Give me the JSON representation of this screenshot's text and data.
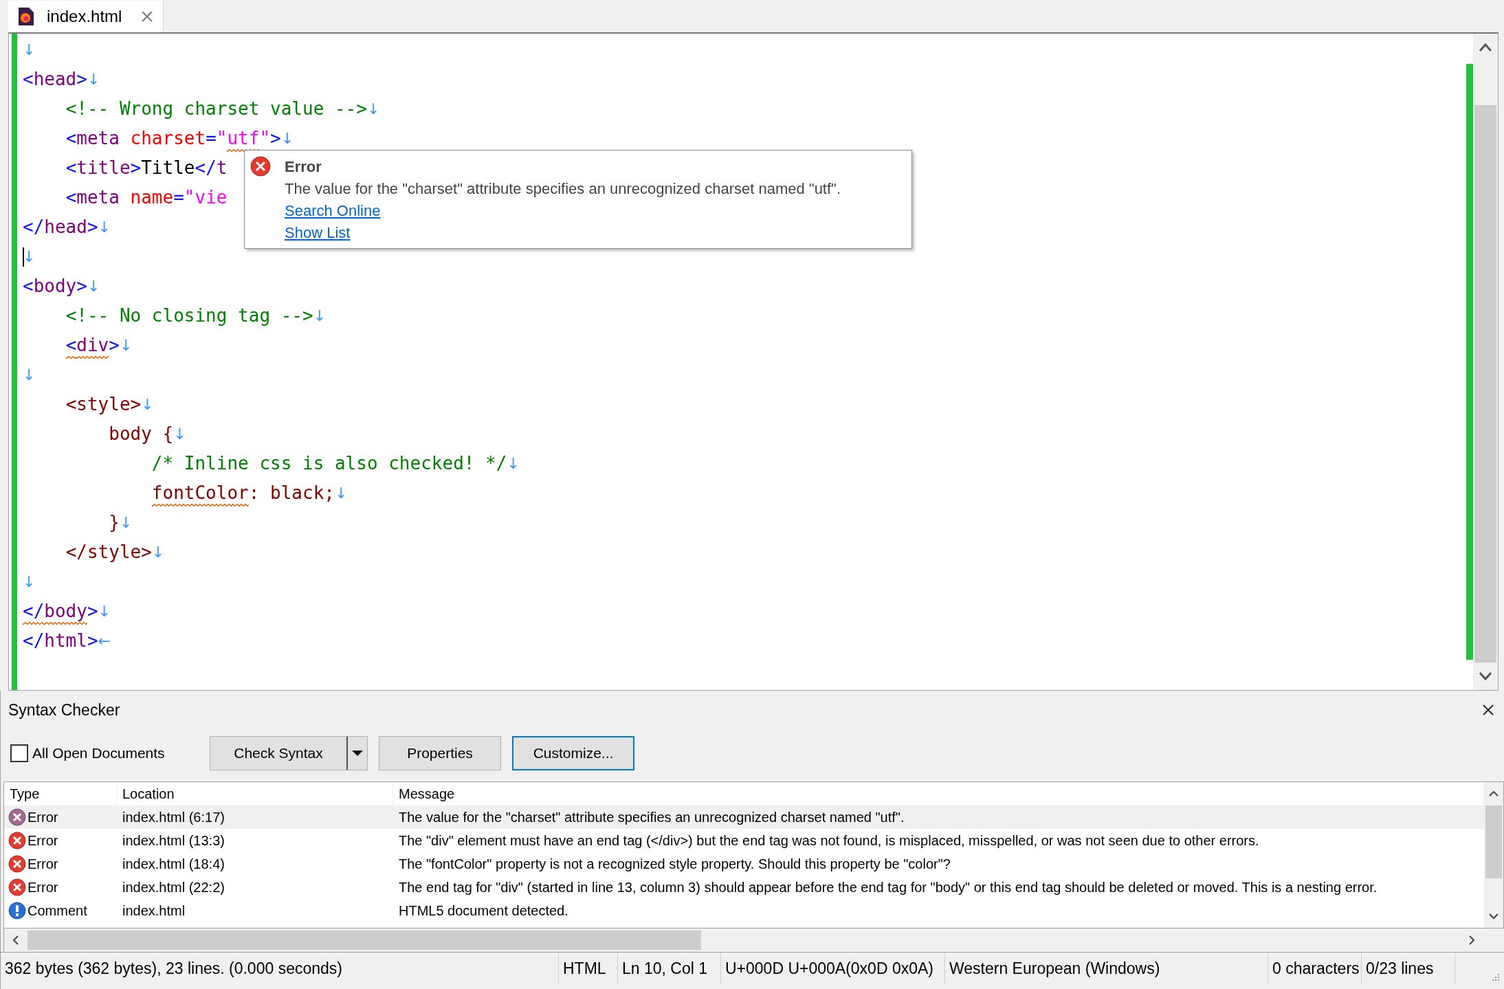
{
  "tab": {
    "label": "index.html",
    "selected": true
  },
  "code_lines": [
    {
      "caret": false,
      "tokens": [
        {
          "kind": "eol",
          "text": "↓",
          "flagged": false
        }
      ]
    },
    {
      "caret": false,
      "tokens": [
        {
          "kind": "bracket",
          "text": "<",
          "flagged": false
        },
        {
          "kind": "tag",
          "text": "head",
          "flagged": false
        },
        {
          "kind": "bracket",
          "text": ">",
          "flagged": false
        },
        {
          "kind": "eol",
          "text": "↓",
          "flagged": false
        }
      ]
    },
    {
      "caret": false,
      "tokens": [
        {
          "kind": "comment",
          "text": "    <!-- Wrong charset value -->",
          "flagged": false
        },
        {
          "kind": "eol",
          "text": "↓",
          "flagged": false
        }
      ]
    },
    {
      "caret": false,
      "tokens": [
        {
          "kind": "bracket",
          "text": "    <",
          "flagged": false
        },
        {
          "kind": "tag",
          "text": "meta",
          "flagged": false
        },
        {
          "kind": "attr",
          "text": " charset",
          "flagged": false
        },
        {
          "kind": "bracket",
          "text": "=",
          "flagged": false
        },
        {
          "kind": "value",
          "text": "\"",
          "flagged": false
        },
        {
          "kind": "value",
          "text": "utf",
          "flagged": true
        },
        {
          "kind": "value",
          "text": "\"",
          "flagged": false
        },
        {
          "kind": "bracket",
          "text": ">",
          "flagged": false
        },
        {
          "kind": "eol",
          "text": "↓",
          "flagged": false
        }
      ]
    },
    {
      "caret": false,
      "tokens": [
        {
          "kind": "bracket",
          "text": "    <",
          "flagged": false
        },
        {
          "kind": "tag",
          "text": "title",
          "flagged": false
        },
        {
          "kind": "bracket",
          "text": ">",
          "flagged": false
        },
        {
          "kind": "text",
          "text": "Title",
          "flagged": false
        },
        {
          "kind": "bracket",
          "text": "</",
          "flagged": false
        },
        {
          "kind": "tag",
          "text": "t",
          "flagged": false
        }
      ]
    },
    {
      "caret": false,
      "tokens": [
        {
          "kind": "bracket",
          "text": "    <",
          "flagged": false
        },
        {
          "kind": "tag",
          "text": "meta",
          "flagged": false
        },
        {
          "kind": "attr",
          "text": " name",
          "flagged": false
        },
        {
          "kind": "bracket",
          "text": "=",
          "flagged": false
        },
        {
          "kind": "value",
          "text": "\"vie",
          "flagged": false
        }
      ]
    },
    {
      "caret": false,
      "tokens": [
        {
          "kind": "bracket",
          "text": "</",
          "flagged": false
        },
        {
          "kind": "tag",
          "text": "head",
          "flagged": false
        },
        {
          "kind": "bracket",
          "text": ">",
          "flagged": false
        },
        {
          "kind": "eol",
          "text": "↓",
          "flagged": false
        }
      ]
    },
    {
      "caret": true,
      "tokens": [
        {
          "kind": "eol",
          "text": "↓",
          "flagged": false
        }
      ]
    },
    {
      "caret": false,
      "tokens": [
        {
          "kind": "bracket",
          "text": "<",
          "flagged": false
        },
        {
          "kind": "tag",
          "text": "body",
          "flagged": false
        },
        {
          "kind": "bracket",
          "text": ">",
          "flagged": false
        },
        {
          "kind": "eol",
          "text": "↓",
          "flagged": false
        }
      ]
    },
    {
      "caret": false,
      "tokens": [
        {
          "kind": "comment",
          "text": "    <!-- No closing tag -->",
          "flagged": false
        },
        {
          "kind": "eol",
          "text": "↓",
          "flagged": false
        }
      ]
    },
    {
      "caret": false,
      "tokens": [
        {
          "kind": "bracket",
          "text": "    <",
          "flagged": true
        },
        {
          "kind": "tag",
          "text": "div",
          "flagged": true
        },
        {
          "kind": "bracket",
          "text": ">",
          "flagged": false
        },
        {
          "kind": "eol",
          "text": "↓",
          "flagged": false
        }
      ]
    },
    {
      "caret": false,
      "tokens": [
        {
          "kind": "eol",
          "text": "↓",
          "flagged": false
        }
      ]
    },
    {
      "caret": false,
      "tokens": [
        {
          "kind": "style",
          "text": "    <style>",
          "flagged": false
        },
        {
          "kind": "eol",
          "text": "↓",
          "flagged": false
        }
      ]
    },
    {
      "caret": false,
      "tokens": [
        {
          "kind": "style",
          "text": "        body {",
          "flagged": false
        },
        {
          "kind": "eol",
          "text": "↓",
          "flagged": false
        }
      ]
    },
    {
      "caret": false,
      "tokens": [
        {
          "kind": "comment",
          "text": "            /* Inline css is also checked! */",
          "flagged": false
        },
        {
          "kind": "eol",
          "text": "↓",
          "flagged": false
        }
      ]
    },
    {
      "caret": false,
      "tokens": [
        {
          "kind": "style",
          "text": "            fontColor",
          "flagged": true
        },
        {
          "kind": "style",
          "text": ": black;",
          "flagged": false
        },
        {
          "kind": "eol",
          "text": "↓",
          "flagged": false
        }
      ]
    },
    {
      "caret": false,
      "tokens": [
        {
          "kind": "style",
          "text": "        }",
          "flagged": false
        },
        {
          "kind": "eol",
          "text": "↓",
          "flagged": false
        }
      ]
    },
    {
      "caret": false,
      "tokens": [
        {
          "kind": "style",
          "text": "    </style>",
          "flagged": false
        },
        {
          "kind": "eol",
          "text": "↓",
          "flagged": false
        }
      ]
    },
    {
      "caret": false,
      "tokens": [
        {
          "kind": "eol",
          "text": "↓",
          "flagged": false
        }
      ]
    },
    {
      "caret": false,
      "tokens": [
        {
          "kind": "bracket",
          "text": "</",
          "flagged": true
        },
        {
          "kind": "tag",
          "text": "body",
          "flagged": true
        },
        {
          "kind": "bracket",
          "text": ">",
          "flagged": false
        },
        {
          "kind": "eol",
          "text": "↓",
          "flagged": false
        }
      ]
    },
    {
      "caret": false,
      "tokens": [
        {
          "kind": "bracket",
          "text": "</",
          "flagged": false
        },
        {
          "kind": "tag",
          "text": "html",
          "flagged": false
        },
        {
          "kind": "bracket",
          "text": ">",
          "flagged": false
        },
        {
          "kind": "eol",
          "text": "←",
          "flagged": false
        }
      ]
    }
  ],
  "tooltip": {
    "title": "Error",
    "message": "The value for the \"charset\" attribute specifies an unrecognized charset named \"utf\".",
    "links": [
      "Search Online",
      "Show List"
    ]
  },
  "syntax_checker": {
    "title": "Syntax Checker",
    "all_open_documents": {
      "label": "All Open Documents",
      "checked": false
    },
    "buttons": [
      {
        "label": "Check Syntax",
        "kind": "split",
        "focused": false
      },
      {
        "label": "Properties",
        "kind": "plain",
        "focused": false
      },
      {
        "label": "Customize...",
        "kind": "plain",
        "focused": true
      }
    ],
    "columns": [
      "Type",
      "Location",
      "Message"
    ],
    "rows": [
      {
        "kind": "error",
        "selected": true,
        "type": "Error",
        "location": "index.html (6:17)",
        "message": "The value for the \"charset\" attribute specifies an unrecognized charset named \"utf\"."
      },
      {
        "kind": "error",
        "selected": false,
        "type": "Error",
        "location": "index.html (13:3)",
        "message": "The \"div\" element must have an end tag (</div>) but the end tag was not found, is misplaced, misspelled, or was not seen due to other errors."
      },
      {
        "kind": "error",
        "selected": false,
        "type": "Error",
        "location": "index.html (18:4)",
        "message": "The \"fontColor\" property is not a recognized style property. Should this property be \"color\"?"
      },
      {
        "kind": "error",
        "selected": false,
        "type": "Error",
        "location": "index.html (22:2)",
        "message": "The end tag for \"div\" (started in line 13, column 3) should appear before the end tag for \"body\" or this end tag should be deleted or moved. This is a nesting error."
      },
      {
        "kind": "comment",
        "selected": false,
        "type": "Comment",
        "location": "index.html",
        "message": "HTML5 document detected."
      }
    ]
  },
  "status_bar": [
    "362 bytes (362 bytes), 23 lines. (0.000 seconds)",
    "HTML",
    "Ln 10, Col 1",
    "U+000D U+000A(0x0D 0x0A)",
    "Western European (Windows)",
    "0 characters",
    "0/23 lines"
  ]
}
